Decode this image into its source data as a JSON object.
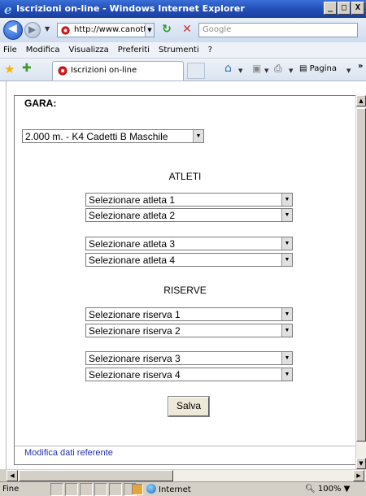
{
  "window": {
    "title": "Iscrizioni on-line - Windows Internet Explorer",
    "controls": [
      "_",
      "□",
      "X"
    ]
  },
  "address_bar": {
    "url": "http://www.canottieri",
    "search_placeholder": "Google"
  },
  "menu": {
    "items": [
      "File",
      "Modifica",
      "Visualizza",
      "Preferiti",
      "Strumenti",
      "?"
    ]
  },
  "tab": {
    "label": "Iscrizioni on-line"
  },
  "toolbar": {
    "page_label": "Pagina",
    "more": "»"
  },
  "form": {
    "gara_label": "GARA:",
    "gara_value": "2.000 m. - K4 Cadetti B Maschile",
    "atleti_heading": "ATLETI",
    "atleti": [
      "Selezionare atleta 1",
      "Selezionare atleta 2",
      "Selezionare atleta 3",
      "Selezionare atleta 4"
    ],
    "riserve_heading": "RISERVE",
    "riserve": [
      "Selezionare riserva 1",
      "Selezionare riserva 2",
      "Selezionare riserva 3",
      "Selezionare riserva 4"
    ],
    "save_label": "Salva",
    "footer_link": "Modifica dati referente"
  },
  "status": {
    "text": "Fine",
    "zone": "Internet",
    "zoom": "100%"
  }
}
